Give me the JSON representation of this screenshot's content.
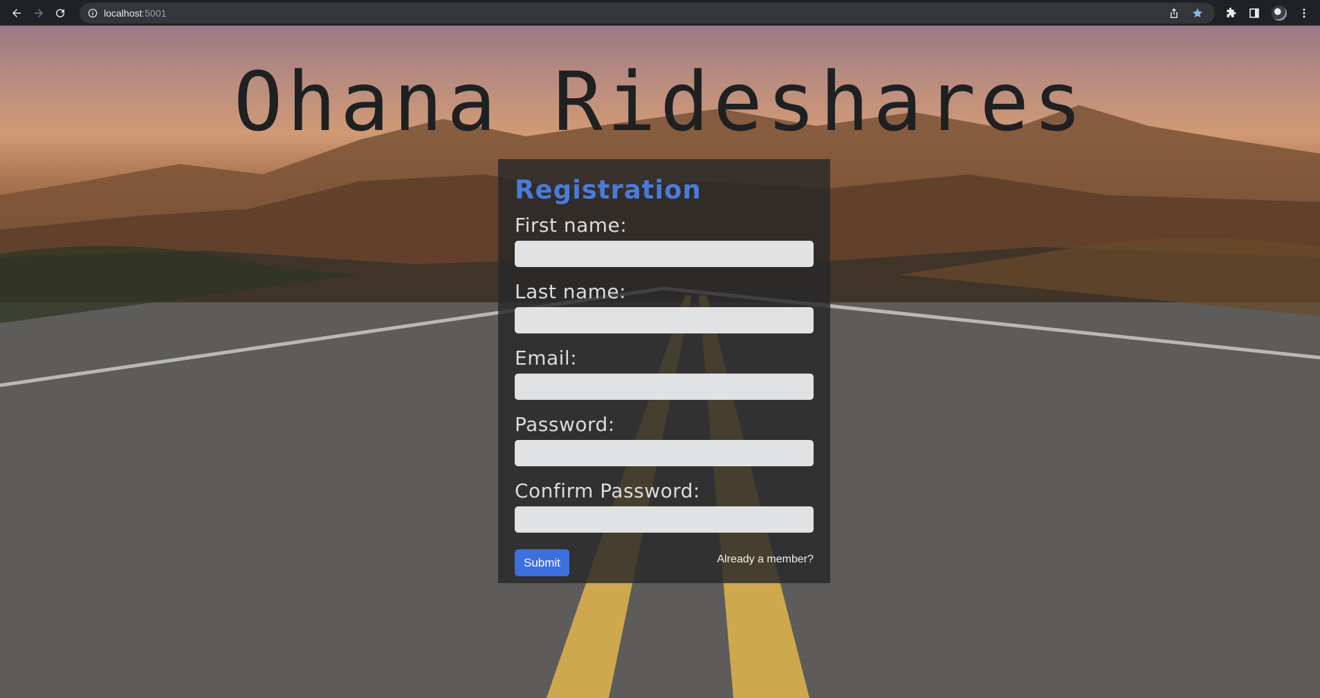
{
  "browser": {
    "url_host": "localhost",
    "url_port": ":5001"
  },
  "site": {
    "title": "Ohana Rideshares"
  },
  "registration": {
    "heading": "Registration",
    "fields": [
      {
        "label": "First name:",
        "value": ""
      },
      {
        "label": "Last name:",
        "value": ""
      },
      {
        "label": "Email:",
        "value": ""
      },
      {
        "label": "Password:",
        "value": ""
      },
      {
        "label": "Confirm Password:",
        "value": ""
      }
    ],
    "submit_label": "Submit",
    "member_link": "Already a member?"
  },
  "colors": {
    "heading_accent": "#4a7bd9",
    "submit_button": "#3d6fe0",
    "card_background": "rgba(40,40,42,0.82)"
  }
}
